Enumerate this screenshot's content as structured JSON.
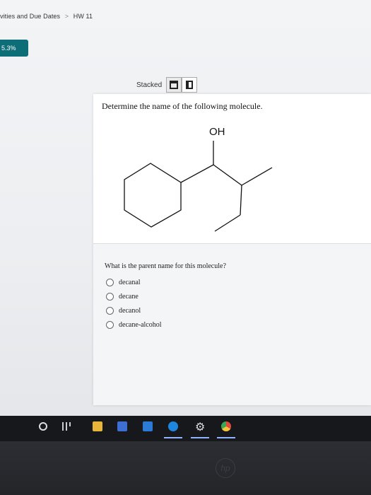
{
  "breadcrumb": {
    "parent": "ivities and Due Dates",
    "separator": ">",
    "current": "HW 11"
  },
  "progress": {
    "label": "5.3%"
  },
  "view_toggle": {
    "label": "Stacked"
  },
  "question": {
    "prompt": "Determine the name of the following molecule.",
    "molecule_label": "OH",
    "sub_prompt": "What is the parent name for this molecule?",
    "options": [
      {
        "label": "decanal"
      },
      {
        "label": "decane"
      },
      {
        "label": "decanol"
      },
      {
        "label": "decane-alcohol"
      }
    ]
  },
  "taskbar": {
    "icons": [
      "start-circle-icon",
      "task-view-icon",
      "file-explorer-icon",
      "store-icon",
      "mail-icon",
      "edge-icon",
      "settings-gear-icon",
      "chrome-icon"
    ]
  },
  "colors": {
    "progress_bg": "#0d6e77",
    "taskbar_bg": "#17181c",
    "card_bg": "#ffffff"
  }
}
